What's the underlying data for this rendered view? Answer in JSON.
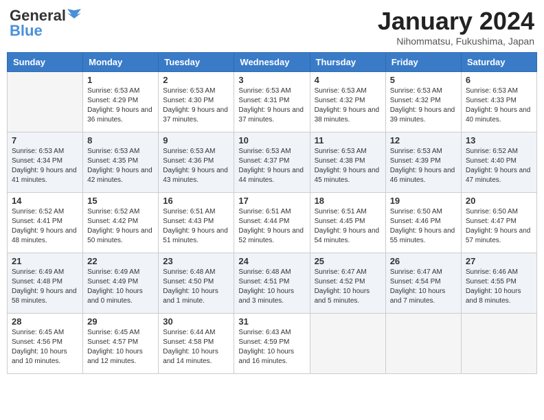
{
  "header": {
    "logo_general": "General",
    "logo_blue": "Blue",
    "month_title": "January 2024",
    "subtitle": "Nihommatsu, Fukushima, Japan"
  },
  "weekdays": [
    "Sunday",
    "Monday",
    "Tuesday",
    "Wednesday",
    "Thursday",
    "Friday",
    "Saturday"
  ],
  "weeks": [
    [
      {
        "day": "",
        "info": ""
      },
      {
        "day": "1",
        "info": "Sunrise: 6:53 AM\nSunset: 4:29 PM\nDaylight: 9 hours and 36 minutes."
      },
      {
        "day": "2",
        "info": "Sunrise: 6:53 AM\nSunset: 4:30 PM\nDaylight: 9 hours and 37 minutes."
      },
      {
        "day": "3",
        "info": "Sunrise: 6:53 AM\nSunset: 4:31 PM\nDaylight: 9 hours and 37 minutes."
      },
      {
        "day": "4",
        "info": "Sunrise: 6:53 AM\nSunset: 4:32 PM\nDaylight: 9 hours and 38 minutes."
      },
      {
        "day": "5",
        "info": "Sunrise: 6:53 AM\nSunset: 4:32 PM\nDaylight: 9 hours and 39 minutes."
      },
      {
        "day": "6",
        "info": "Sunrise: 6:53 AM\nSunset: 4:33 PM\nDaylight: 9 hours and 40 minutes."
      }
    ],
    [
      {
        "day": "7",
        "info": "Sunrise: 6:53 AM\nSunset: 4:34 PM\nDaylight: 9 hours and 41 minutes."
      },
      {
        "day": "8",
        "info": "Sunrise: 6:53 AM\nSunset: 4:35 PM\nDaylight: 9 hours and 42 minutes."
      },
      {
        "day": "9",
        "info": "Sunrise: 6:53 AM\nSunset: 4:36 PM\nDaylight: 9 hours and 43 minutes."
      },
      {
        "day": "10",
        "info": "Sunrise: 6:53 AM\nSunset: 4:37 PM\nDaylight: 9 hours and 44 minutes."
      },
      {
        "day": "11",
        "info": "Sunrise: 6:53 AM\nSunset: 4:38 PM\nDaylight: 9 hours and 45 minutes."
      },
      {
        "day": "12",
        "info": "Sunrise: 6:53 AM\nSunset: 4:39 PM\nDaylight: 9 hours and 46 minutes."
      },
      {
        "day": "13",
        "info": "Sunrise: 6:52 AM\nSunset: 4:40 PM\nDaylight: 9 hours and 47 minutes."
      }
    ],
    [
      {
        "day": "14",
        "info": "Sunrise: 6:52 AM\nSunset: 4:41 PM\nDaylight: 9 hours and 48 minutes."
      },
      {
        "day": "15",
        "info": "Sunrise: 6:52 AM\nSunset: 4:42 PM\nDaylight: 9 hours and 50 minutes."
      },
      {
        "day": "16",
        "info": "Sunrise: 6:51 AM\nSunset: 4:43 PM\nDaylight: 9 hours and 51 minutes."
      },
      {
        "day": "17",
        "info": "Sunrise: 6:51 AM\nSunset: 4:44 PM\nDaylight: 9 hours and 52 minutes."
      },
      {
        "day": "18",
        "info": "Sunrise: 6:51 AM\nSunset: 4:45 PM\nDaylight: 9 hours and 54 minutes."
      },
      {
        "day": "19",
        "info": "Sunrise: 6:50 AM\nSunset: 4:46 PM\nDaylight: 9 hours and 55 minutes."
      },
      {
        "day": "20",
        "info": "Sunrise: 6:50 AM\nSunset: 4:47 PM\nDaylight: 9 hours and 57 minutes."
      }
    ],
    [
      {
        "day": "21",
        "info": "Sunrise: 6:49 AM\nSunset: 4:48 PM\nDaylight: 9 hours and 58 minutes."
      },
      {
        "day": "22",
        "info": "Sunrise: 6:49 AM\nSunset: 4:49 PM\nDaylight: 10 hours and 0 minutes."
      },
      {
        "day": "23",
        "info": "Sunrise: 6:48 AM\nSunset: 4:50 PM\nDaylight: 10 hours and 1 minute."
      },
      {
        "day": "24",
        "info": "Sunrise: 6:48 AM\nSunset: 4:51 PM\nDaylight: 10 hours and 3 minutes."
      },
      {
        "day": "25",
        "info": "Sunrise: 6:47 AM\nSunset: 4:52 PM\nDaylight: 10 hours and 5 minutes."
      },
      {
        "day": "26",
        "info": "Sunrise: 6:47 AM\nSunset: 4:54 PM\nDaylight: 10 hours and 7 minutes."
      },
      {
        "day": "27",
        "info": "Sunrise: 6:46 AM\nSunset: 4:55 PM\nDaylight: 10 hours and 8 minutes."
      }
    ],
    [
      {
        "day": "28",
        "info": "Sunrise: 6:45 AM\nSunset: 4:56 PM\nDaylight: 10 hours and 10 minutes."
      },
      {
        "day": "29",
        "info": "Sunrise: 6:45 AM\nSunset: 4:57 PM\nDaylight: 10 hours and 12 minutes."
      },
      {
        "day": "30",
        "info": "Sunrise: 6:44 AM\nSunset: 4:58 PM\nDaylight: 10 hours and 14 minutes."
      },
      {
        "day": "31",
        "info": "Sunrise: 6:43 AM\nSunset: 4:59 PM\nDaylight: 10 hours and 16 minutes."
      },
      {
        "day": "",
        "info": ""
      },
      {
        "day": "",
        "info": ""
      },
      {
        "day": "",
        "info": ""
      }
    ]
  ]
}
